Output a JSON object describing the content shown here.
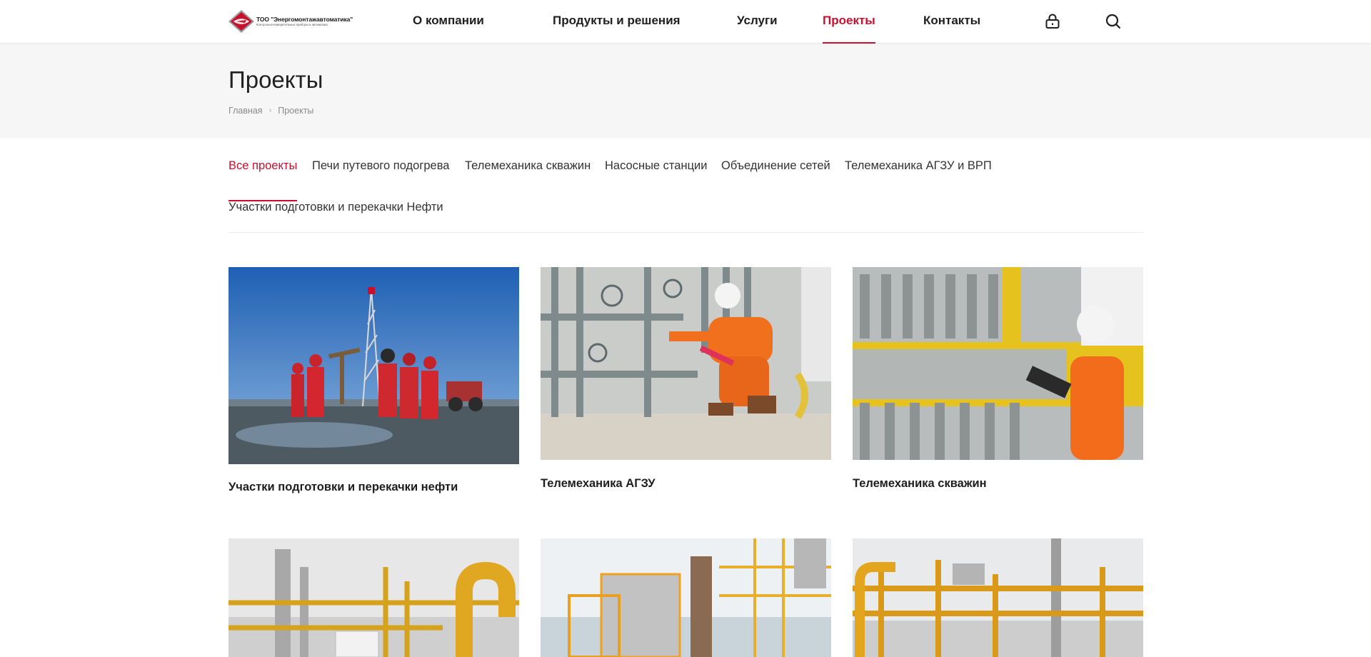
{
  "header": {
    "logo_name": "ТОО \"Энергомонтажавтоматика\"",
    "logo_sub": "Контрольно-измерительные приборы и автоматика",
    "nav": [
      {
        "label": "О компании",
        "active": false
      },
      {
        "label": "Продукты и решения",
        "active": false
      },
      {
        "label": "Услуги",
        "active": false
      },
      {
        "label": "Проекты",
        "active": true
      },
      {
        "label": "Контакты",
        "active": false
      }
    ],
    "icons": [
      "lock-icon",
      "search-icon"
    ],
    "accent_color": "#c8102e"
  },
  "page": {
    "title": "Проекты",
    "breadcrumb": [
      "Главная",
      "Проекты"
    ]
  },
  "filters": [
    {
      "label": "Все проекты",
      "active": true
    },
    {
      "label": "Печи путевого подогрева",
      "active": false
    },
    {
      "label": "Телемеханика скважин",
      "active": false
    },
    {
      "label": "Насосные станции",
      "active": false
    },
    {
      "label": "Объединение сетей",
      "active": false
    },
    {
      "label": "Телемеханика АГЗУ и ВРП",
      "active": false
    },
    {
      "label": "Участки подготовки и перекачки Нефти",
      "active": false
    }
  ],
  "projects": [
    {
      "title": "Участки подготовки и перекачки нефти",
      "image": "oilfield-workers-photo"
    },
    {
      "title": "Телемеханика АГЗУ",
      "image": "engineer-valves-photo"
    },
    {
      "title": "Телемеханика скважин",
      "image": "engineer-panel-photo"
    },
    {
      "title": "",
      "image": "refinery-yellow-pipes-photo"
    },
    {
      "title": "",
      "image": "offshore-platform-photo"
    },
    {
      "title": "",
      "image": "gas-plant-photo"
    }
  ]
}
